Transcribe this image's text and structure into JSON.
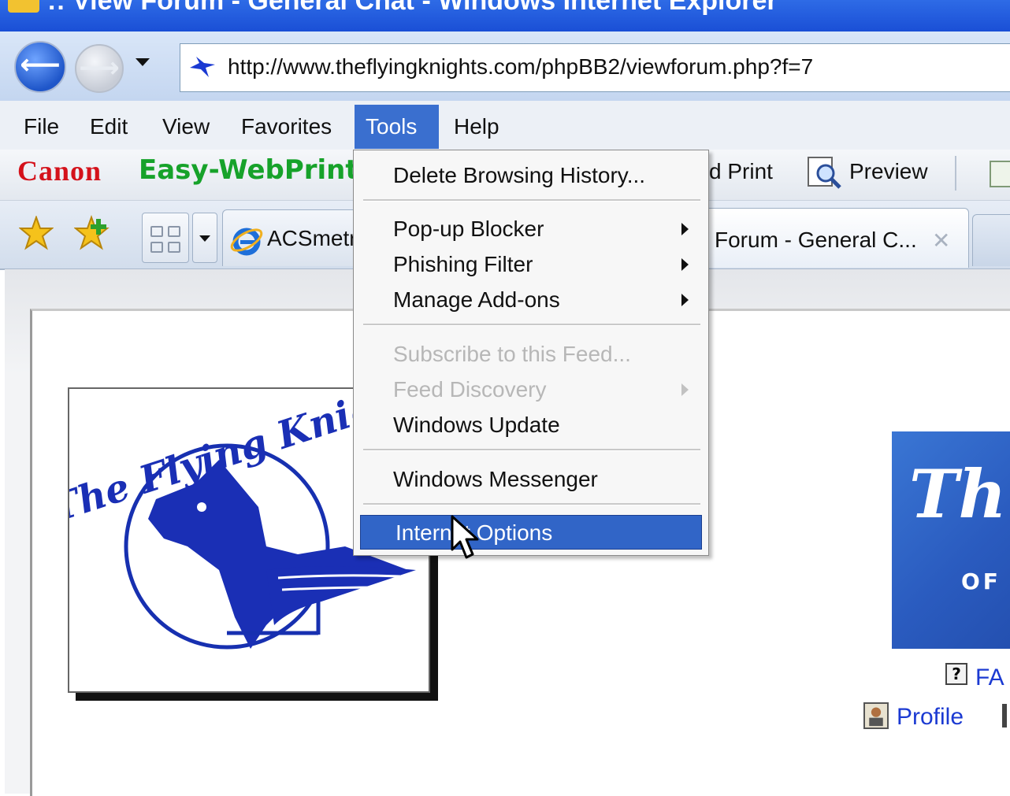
{
  "window": {
    "title": ":: View Forum - General Chat - Windows Internet Explorer"
  },
  "navigation": {
    "back_icon": "back-arrow-icon",
    "forward_icon": "forward-arrow-icon",
    "address": "http://www.theflyingknights.com/phpBB2/viewforum.php?f=7"
  },
  "menubar": {
    "items": [
      "File",
      "Edit",
      "View",
      "Favorites",
      "Tools",
      "Help"
    ],
    "active": "Tools",
    "active_color": "#3a6fcf"
  },
  "canon_toolbar": {
    "brand": "Canon",
    "product": "Easy-WebPrint",
    "print_label": "d Print",
    "preview_label": "Preview",
    "brand_color": "#d4121b",
    "product_color": "#16a22a"
  },
  "tabs": {
    "items": [
      {
        "label": "ACSmetrics"
      },
      {
        "label": "Forum - General C..."
      }
    ]
  },
  "tools_menu": {
    "items": [
      {
        "label": "Delete Browsing History...",
        "enabled": true
      },
      {
        "label": "Pop-up Blocker",
        "enabled": true,
        "submenu": true
      },
      {
        "label": "Phishing Filter",
        "enabled": true,
        "submenu": true
      },
      {
        "label": "Manage Add-ons",
        "enabled": true,
        "submenu": true
      },
      {
        "label": "Subscribe to this Feed...",
        "enabled": false
      },
      {
        "label": "Feed Discovery",
        "enabled": false,
        "submenu": true
      },
      {
        "label": "Windows Update",
        "enabled": true
      },
      {
        "label": "Windows Messenger",
        "enabled": true
      },
      {
        "label": "Internet Options",
        "enabled": true,
        "highlighted": true
      }
    ],
    "highlight_color": "#3165c7"
  },
  "page": {
    "logo_text": "The Flying Knights",
    "banner_text": "Th",
    "banner_subtext": "OF",
    "links": {
      "faq": "FA",
      "profile": "Profile"
    },
    "link_color": "#1b3ad2"
  }
}
